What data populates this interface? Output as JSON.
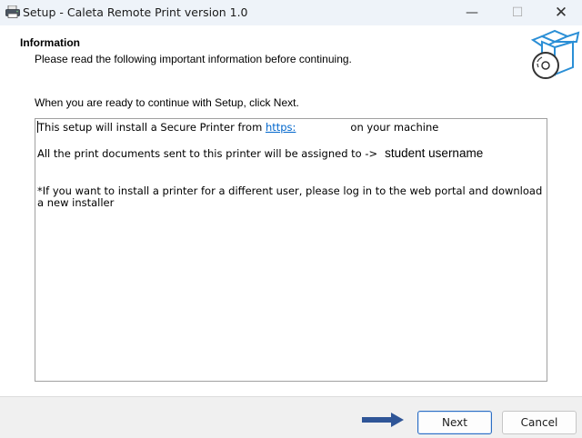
{
  "window": {
    "title": "Setup - Caleta Remote Print version 1.0",
    "controls": {
      "minimize": "—",
      "maximize": "☐",
      "close": "✕"
    }
  },
  "header": {
    "title": "Information",
    "subtitle": "Please read the following important information before continuing.",
    "icon": "software-box-cd-icon"
  },
  "body": {
    "instructions": "When you are ready to continue with Setup, click Next.",
    "info": {
      "line1_prefix": "This setup will install a Secure Printer from ",
      "line1_link": "https:",
      "line1_suffix": "on your machine",
      "line2_text": "All the print documents sent to this printer will be assigned to ->",
      "line2_annotation": "student username",
      "line3_text": "*If you want to install a printer for a different user, please log in to the web portal and download a new installer"
    }
  },
  "footer": {
    "next_label": "Next",
    "cancel_label": "Cancel",
    "arrow_icon": "right-arrow-icon"
  },
  "colors": {
    "accent": "#2d6fc4",
    "link": "#0066cc",
    "titlebar": "#eef3f9",
    "footer": "#f0f0f0"
  }
}
